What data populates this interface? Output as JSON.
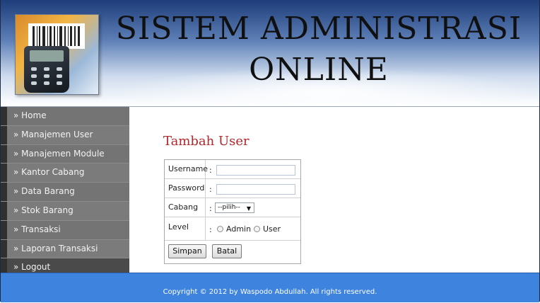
{
  "header": {
    "title_line1": "SISTEM ADMINISTRASI",
    "title_line2": "ONLINE"
  },
  "sidebar": {
    "items": [
      {
        "label": "» Home"
      },
      {
        "label": "» Manajemen User"
      },
      {
        "label": "» Manajemen Module"
      },
      {
        "label": "» Kantor Cabang"
      },
      {
        "label": "» Data Barang"
      },
      {
        "label": "» Stok Barang"
      },
      {
        "label": "» Transaksi"
      },
      {
        "label": "» Laporan Transaksi"
      },
      {
        "label": "» Logout"
      }
    ]
  },
  "main": {
    "page_title": "Tambah User",
    "form": {
      "username_label": "Username",
      "username_value": "",
      "password_label": "Password",
      "password_value": "",
      "cabang_label": "Cabang",
      "cabang_selected": "--pilih--",
      "level_label": "Level",
      "level_options": [
        "Admin",
        "User"
      ],
      "colon": ":",
      "save_label": "Simpan",
      "cancel_label": "Batal"
    }
  },
  "footer": {
    "copyright": "Copyright © 2012 by Waspodo Abdullah. All rights reserved."
  },
  "colors": {
    "header_top": "#1e3d7a",
    "sidebar": "#7d7d7d",
    "title_red": "#b3262a",
    "footer": "#3e83dd"
  },
  "icons": {
    "logo": "barcode-scanner-icon",
    "select_arrow": "chevron-down-icon"
  }
}
